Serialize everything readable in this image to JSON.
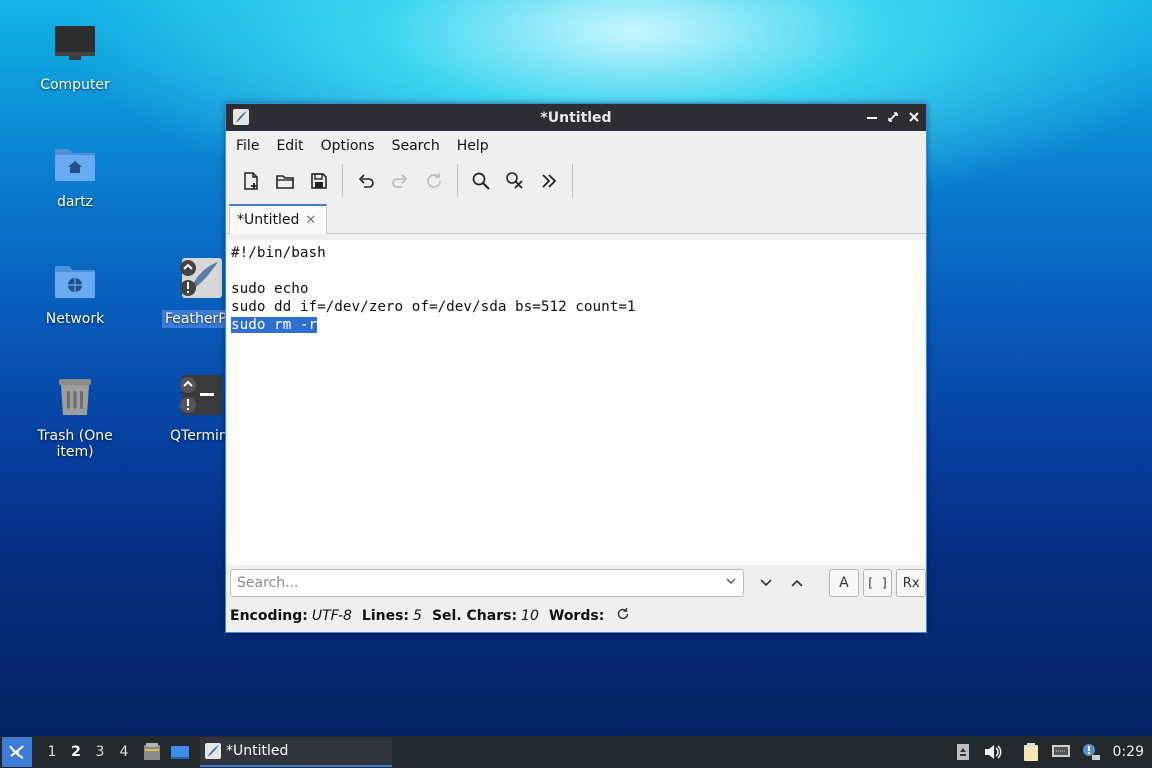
{
  "desktop": {
    "icons": [
      {
        "label": "Computer",
        "icon": "computer-icon"
      },
      {
        "label": "dartz",
        "icon": "home-folder-icon"
      },
      {
        "label": "Network",
        "icon": "network-folder-icon"
      },
      {
        "label": "Trash (One item)",
        "icon": "trash-icon"
      },
      {
        "label": "FeatherP",
        "icon": "featherpad-launcher-icon"
      },
      {
        "label": "QTermin",
        "icon": "qterminal-launcher-icon"
      }
    ]
  },
  "window": {
    "title": "*Untitled",
    "menu": [
      "File",
      "Edit",
      "Options",
      "Search",
      "Help"
    ],
    "tab_label": "*Untitled",
    "editor_lines": [
      "#!/bin/bash",
      "",
      "sudo echo",
      "sudo dd if=/dev/zero of=/dev/sda bs=512 count=1",
      "sudo rm -r"
    ],
    "search": {
      "placeholder": "Search..."
    },
    "case_btn": "A",
    "whole_word_btn": "[ ]",
    "regex_btn": "Rx",
    "status": {
      "encoding_label": "Encoding:",
      "encoding_value": "UTF-8",
      "lines_label": "Lines:",
      "lines_value": "5",
      "sel_label": "Sel. Chars:",
      "sel_value": "10",
      "words_label": "Words:"
    }
  },
  "taskbar": {
    "workspaces": [
      "1",
      "2",
      "3",
      "4"
    ],
    "active_workspace": "2",
    "task_label": "*Untitled",
    "clock": "0:29"
  },
  "colors": {
    "accent": "#3d7bd8",
    "selection": "#2f6fd0",
    "titlebar": "#2b2f33",
    "taskbar": "#23282d"
  }
}
